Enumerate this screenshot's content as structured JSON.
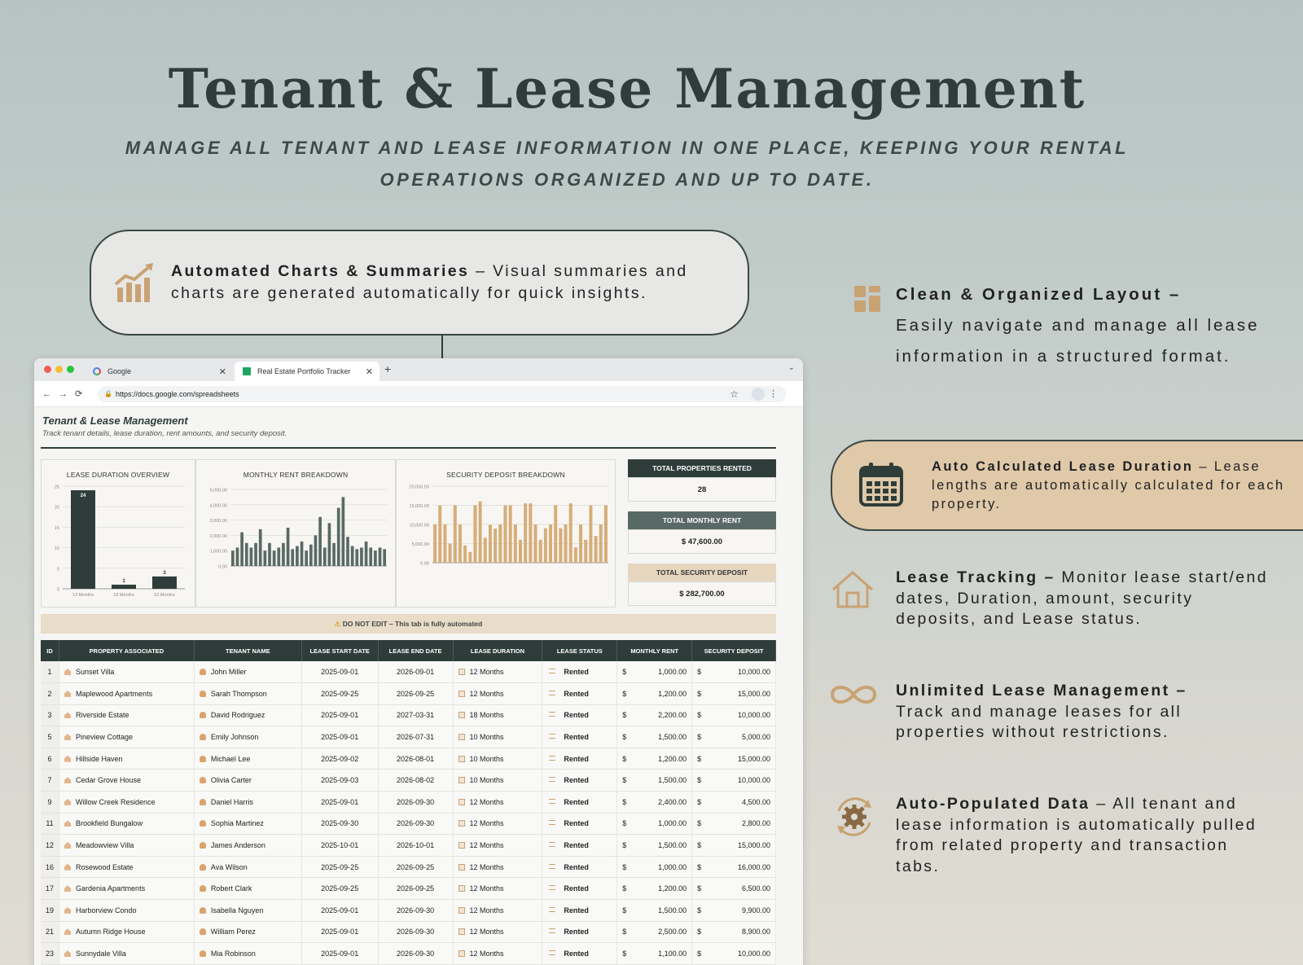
{
  "hero": {
    "title": "Tenant & Lease Management",
    "subtitle_line1": "MANAGE ALL TENANT AND LEASE INFORMATION IN ONE PLACE, KEEPING YOUR RENTAL",
    "subtitle_line2": "OPERATIONS ORGANIZED AND UP TO DATE."
  },
  "callout": {
    "heading": "Automated Charts & Summaries",
    "text": " – Visual summaries and charts are generated automatically for quick insights."
  },
  "features": [
    {
      "heading": "Clean & Organized Layout –",
      "text": "Easily navigate and manage all lease information in a structured format.",
      "icon": "layout-grid-icon"
    },
    {
      "heading": "Auto Calculated Lease Duration",
      "text": " – Lease lengths are automatically calculated for each property.",
      "icon": "calendar-icon"
    },
    {
      "heading": "Lease Tracking –",
      "text": " Monitor lease start/end dates, Duration, amount, security deposits, and Lease status.",
      "icon": "house-icon"
    },
    {
      "heading": "Unlimited Lease Management –",
      "text": " Track and manage leases for all properties without restrictions.",
      "icon": "infinity-icon"
    },
    {
      "heading": "Auto-Populated Data",
      "text": " – All tenant and lease information is automatically pulled from related property and transaction tabs.",
      "icon": "gear-icon"
    }
  ],
  "browser": {
    "tab1": "Google",
    "tab2": "Real Estate Portfolio Tracker",
    "url": "https://docs.google.com/spreadsheets"
  },
  "sheet": {
    "title": "Tenant & Lease Management",
    "subtitle": "Track tenant details, lease duration, rent amounts, and security deposit.",
    "notice": "DO NOT EDIT – This tab is fully automated",
    "kpis": [
      {
        "label": "TOTAL PROPERTIES RENTED",
        "value": "28"
      },
      {
        "label": "TOTAL MONTHLY RENT",
        "value": "$ 47,600.00"
      },
      {
        "label": "TOTAL SECURITY DEPOSIT",
        "value": "$ 282,700.00"
      }
    ],
    "columns": [
      "ID",
      "PROPERTY ASSOCIATED",
      "TENANT NAME",
      "LEASE START DATE",
      "LEASE END DATE",
      "LEASE DURATION",
      "LEASE STATUS",
      "MONTHLY RENT",
      "SECURITY DEPOSIT"
    ],
    "rows": [
      [
        "1",
        "Sunset Villa",
        "John Miller",
        "2025-09-01",
        "2026-09-01",
        "12 Months",
        "Rented",
        "1,000.00",
        "10,000.00"
      ],
      [
        "2",
        "Maplewood Apartments",
        "Sarah Thompson",
        "2025-09-25",
        "2026-09-25",
        "12 Months",
        "Rented",
        "1,200.00",
        "15,000.00"
      ],
      [
        "3",
        "Riverside Estate",
        "David Rodriguez",
        "2025-09-01",
        "2027-03-31",
        "18 Months",
        "Rented",
        "2,200.00",
        "10,000.00"
      ],
      [
        "5",
        "Pineview Cottage",
        "Emily Johnson",
        "2025-09-01",
        "2026-07-31",
        "10 Months",
        "Rented",
        "1,500.00",
        "5,000.00"
      ],
      [
        "6",
        "Hillside Haven",
        "Michael Lee",
        "2025-09-02",
        "2026-08-01",
        "10 Months",
        "Rented",
        "1,200.00",
        "15,000.00"
      ],
      [
        "7",
        "Cedar Grove House",
        "Olivia Carter",
        "2025-09-03",
        "2026-08-02",
        "10 Months",
        "Rented",
        "1,500.00",
        "10,000.00"
      ],
      [
        "9",
        "Willow Creek Residence",
        "Daniel Harris",
        "2025-09-01",
        "2026-09-30",
        "12 Months",
        "Rented",
        "2,400.00",
        "4,500.00"
      ],
      [
        "11",
        "Brookfield Bungalow",
        "Sophia Martinez",
        "2025-09-30",
        "2026-09-30",
        "12 Months",
        "Rented",
        "1,000.00",
        "2,800.00"
      ],
      [
        "12",
        "Meadowview Villa",
        "James Anderson",
        "2025-10-01",
        "2026-10-01",
        "12 Months",
        "Rented",
        "1,500.00",
        "15,000.00"
      ],
      [
        "16",
        "Rosewood Estate",
        "Ava Wilson",
        "2025-09-25",
        "2026-09-25",
        "12 Months",
        "Rented",
        "1,000.00",
        "16,000.00"
      ],
      [
        "17",
        "Gardenia Apartments",
        "Robert Clark",
        "2025-09-25",
        "2026-09-25",
        "12 Months",
        "Rented",
        "1,200.00",
        "6,500.00"
      ],
      [
        "19",
        "Harborview Condo",
        "Isabella Nguyen",
        "2025-09-01",
        "2026-09-30",
        "12 Months",
        "Rented",
        "1,500.00",
        "9,900.00"
      ],
      [
        "21",
        "Autumn Ridge House",
        "William Perez",
        "2025-09-01",
        "2026-09-30",
        "12 Months",
        "Rented",
        "2,500.00",
        "8,900.00"
      ],
      [
        "23",
        "Sunnydale Villa",
        "Mia Robinson",
        "2025-09-01",
        "2026-09-30",
        "12 Months",
        "Rented",
        "1,100.00",
        "10,000.00"
      ]
    ],
    "currency": "$"
  },
  "chart_data": [
    {
      "type": "bar",
      "title": "LEASE DURATION OVERVIEW",
      "categories": [
        "12 Months",
        "18 Months",
        "10 Months"
      ],
      "values": [
        24,
        1,
        3
      ],
      "ylim": [
        0,
        25
      ],
      "yticks": [
        "0",
        "5",
        "10",
        "15",
        "20",
        "25"
      ],
      "color": "#2e3d3a"
    },
    {
      "type": "bar",
      "title": "MONTHLY RENT BREAKDOWN",
      "values": [
        1000,
        1200,
        2200,
        1500,
        1200,
        1500,
        2400,
        1000,
        1500,
        1000,
        1200,
        1500,
        2500,
        1100,
        1300,
        1600,
        1000,
        1400,
        2000,
        3200,
        1200,
        2800,
        1500,
        3800,
        4500,
        1900,
        1300,
        1100,
        1200,
        1600,
        1200,
        1000,
        1200,
        1100
      ],
      "ylim": [
        0,
        5000
      ],
      "yticks": [
        "0.00",
        "1,000.00",
        "2,000.00",
        "3,000.00",
        "4,000.00",
        "5,000.00"
      ],
      "color": "#596966"
    },
    {
      "type": "bar",
      "title": "SECURITY DEPOSIT BREAKDOWN",
      "values": [
        10000,
        15000,
        10000,
        5000,
        15000,
        10000,
        4500,
        2800,
        15000,
        16000,
        6500,
        9900,
        8900,
        10000,
        15000,
        15000,
        10000,
        6000,
        15500,
        15500,
        10000,
        6000,
        9000,
        10000,
        15000,
        9000,
        10000,
        15500,
        4000,
        10000,
        6000,
        15000,
        7000,
        10000,
        15000
      ],
      "ylim": [
        0,
        20000
      ],
      "yticks": [
        "0.00",
        "5,000.00",
        "10,000.00",
        "15,000.00",
        "20,000.00"
      ],
      "color": "#d6ad7a"
    }
  ],
  "colors": {
    "dark": "#2e3d3a",
    "accent": "#c9a274",
    "tan": "#dfc9a9"
  }
}
